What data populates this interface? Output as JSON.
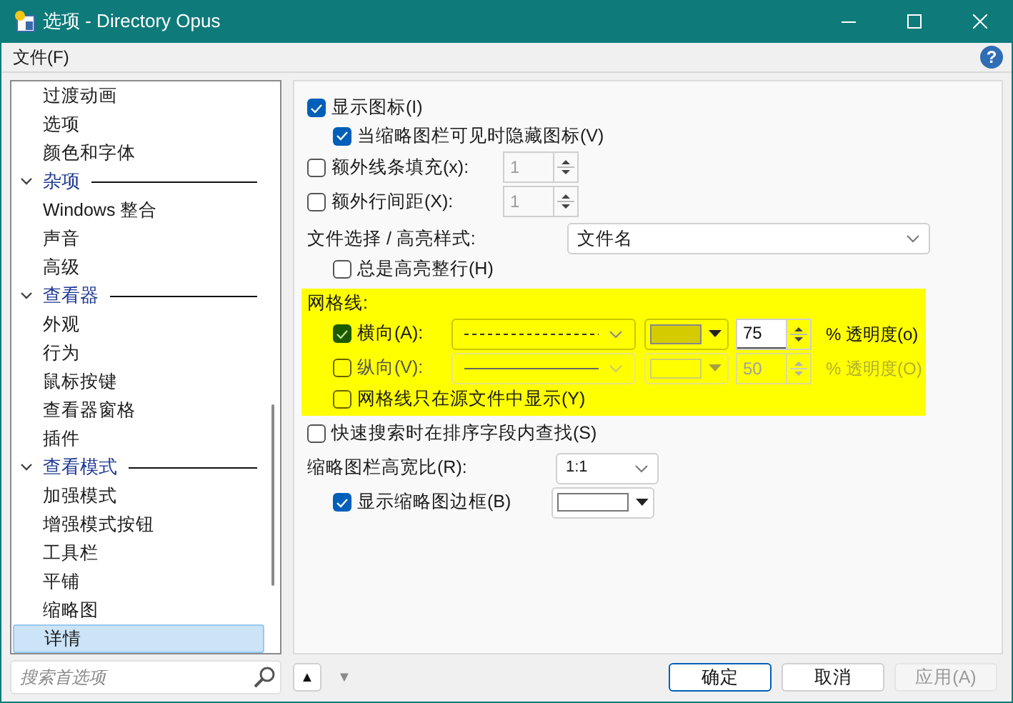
{
  "window": {
    "title": "选项 - Directory Opus"
  },
  "menu": [
    "文件(F)"
  ],
  "help": "?",
  "tree": [
    {
      "label": "过渡动画",
      "selected": false
    },
    {
      "label": "选项",
      "selected": false
    },
    {
      "label": "颜色和字体",
      "selected": false
    },
    {
      "label": "杂项",
      "expanded": true,
      "selected": false,
      "children": [
        {
          "label": "Windows 整合",
          "selected": false
        },
        {
          "label": "声音",
          "selected": false
        },
        {
          "label": "高级",
          "selected": false
        }
      ]
    },
    {
      "label": "查看器",
      "expanded": true,
      "selected": false,
      "children": [
        {
          "label": "外观",
          "selected": false
        },
        {
          "label": "行为",
          "selected": false
        },
        {
          "label": "鼠标按键",
          "selected": false
        },
        {
          "label": "查看器窗格",
          "selected": false
        },
        {
          "label": "插件",
          "selected": false
        }
      ]
    },
    {
      "label": "查看模式",
      "expanded": true,
      "selected": false,
      "children": [
        {
          "label": "加强模式",
          "selected": false
        },
        {
          "label": "增强模式按钮",
          "selected": false
        },
        {
          "label": "工具栏",
          "selected": false
        },
        {
          "label": "平铺",
          "selected": false
        },
        {
          "label": "缩略图",
          "selected": false
        },
        {
          "label": "详情",
          "selected": true
        }
      ]
    }
  ],
  "search": {
    "placeholder": "搜索首选项"
  },
  "settings": [
    {
      "kind": "checkbox",
      "label": "显示图标(I)",
      "checked": true,
      "children": [
        {
          "kind": "checkbox",
          "label": "当缩略图栏可见时隐藏图标(V)",
          "checked": true
        }
      ]
    },
    {
      "kind": "spin",
      "label": "额外线条填充(x):",
      "checked": false,
      "value": "1"
    },
    {
      "kind": "spin",
      "label": "额外行间距(X):",
      "checked": false,
      "value": "1"
    },
    {
      "kind": "select",
      "label": "文件选择 / 高亮样式:",
      "value": "文件名",
      "children": [
        {
          "kind": "checkbox",
          "label": "总是高亮整行(H)",
          "checked": false
        }
      ]
    },
    {
      "kind": "group",
      "label": "网格线:",
      "rows": [
        {
          "label": "横向(A):",
          "checked": true,
          "kind": "dashed",
          "color": "#d4cc00",
          "value": "75",
          "suffix": "% 透明度(o)"
        },
        {
          "label": "纵向(V):",
          "checked": false,
          "kind": "solid",
          "value": "50",
          "suffix": "% 透明度(O)"
        }
      ],
      "children": [
        {
          "kind": "checkbox",
          "label": "网格线只在源文件中显示(Y)",
          "checked": false
        }
      ]
    },
    {
      "kind": "checkbox",
      "label": "快速搜索时在排序字段内查找(S)",
      "checked": false
    },
    {
      "kind": "select",
      "label": "缩略图栏高宽比(R):",
      "value": "1:1",
      "children": [
        {
          "kind": "color_select",
          "label": "显示缩略图边框(B)",
          "checked": true,
          "color": "#ffffff"
        }
      ]
    }
  ],
  "nav": [
    {
      "glyph": "▲",
      "disabled": false
    },
    {
      "glyph": "▼",
      "disabled": true
    }
  ],
  "buttons": [
    {
      "label": "确定",
      "default": true,
      "disabled": false
    },
    {
      "label": "取消",
      "default": false,
      "disabled": false
    },
    {
      "label": "应用(A)",
      "default": false,
      "disabled": true
    }
  ]
}
